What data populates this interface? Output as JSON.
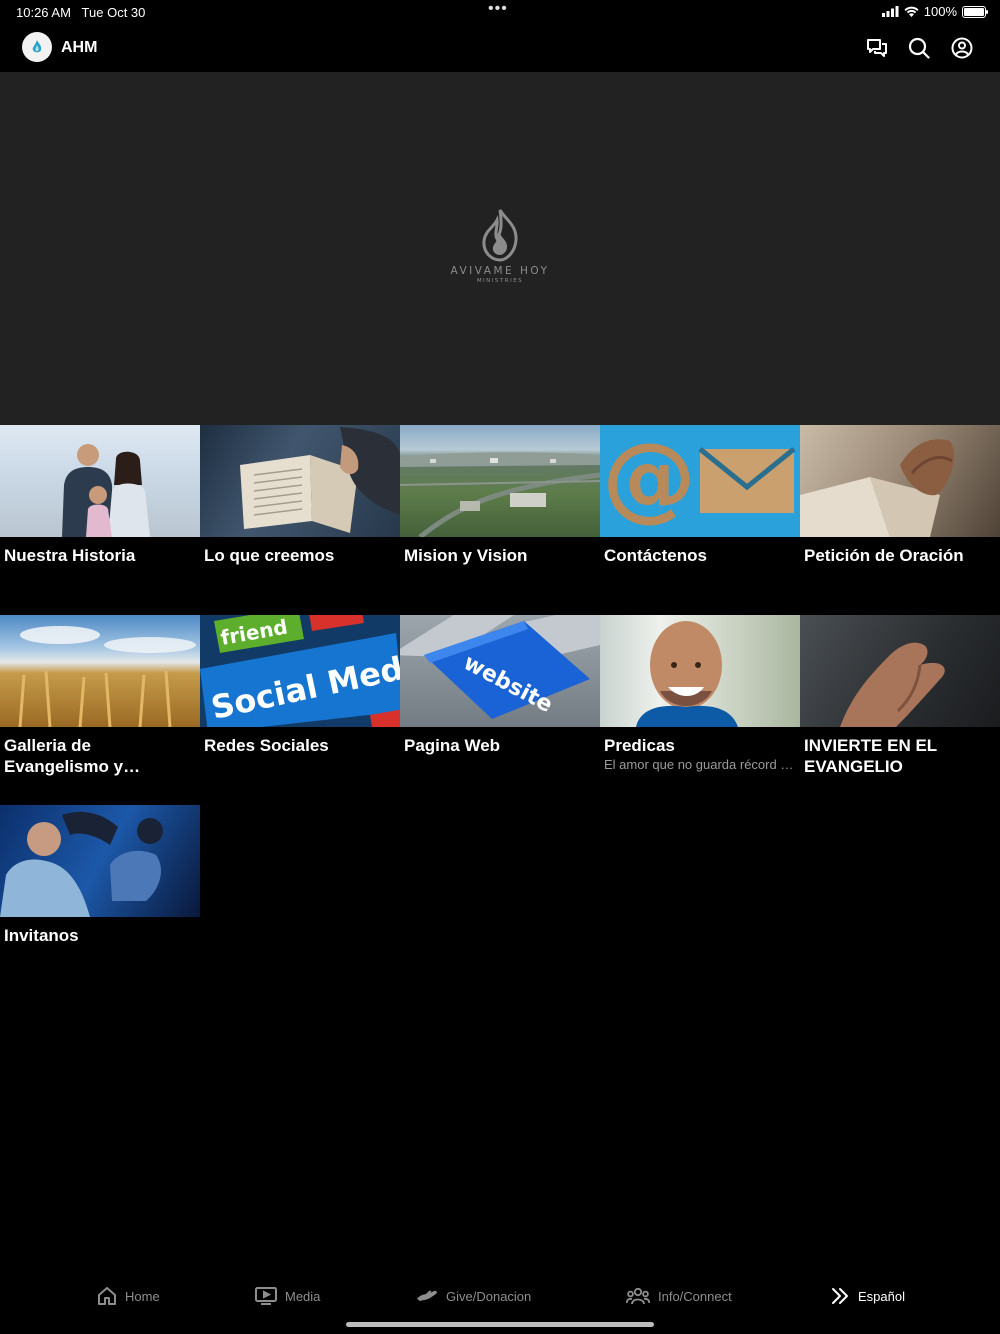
{
  "status_bar": {
    "time": "10:26 AM",
    "date": "Tue Oct 30",
    "battery_percent": "100%",
    "battery_level": 1.0,
    "icons": [
      "cellular-signal-icon",
      "wifi-icon",
      "battery-icon"
    ]
  },
  "header": {
    "title": "AHM",
    "icons": [
      "chat-icon",
      "search-icon",
      "profile-icon"
    ]
  },
  "hero": {
    "logo_text": "AVIVAME HOY",
    "logo_subtext": "MINISTRIES"
  },
  "tiles": [
    {
      "title": "Nuestra Historia",
      "subtitle": ""
    },
    {
      "title": "Lo que creemos",
      "subtitle": ""
    },
    {
      "title": "Mision y Vision",
      "subtitle": ""
    },
    {
      "title": "Contáctenos",
      "subtitle": ""
    },
    {
      "title": "Petición de Oración",
      "subtitle": ""
    },
    {
      "title": "Galleria de Evangelismo y Conferencias",
      "subtitle": ""
    },
    {
      "title": "Redes Sociales",
      "subtitle": "",
      "image_text_1": "friend",
      "image_text_2": "Social Media"
    },
    {
      "title": "Pagina Web",
      "subtitle": "",
      "image_text": "website"
    },
    {
      "title": "Predicas",
      "subtitle": "El amor que no guarda récord de ofensas"
    },
    {
      "title": "INVIERTE EN EL EVANGELIO",
      "subtitle": ""
    },
    {
      "title": "Invitanos",
      "subtitle": ""
    }
  ],
  "tabbar": {
    "tabs": [
      {
        "label": "Home",
        "icon": "home-icon"
      },
      {
        "label": "Media",
        "icon": "tv-play-icon"
      },
      {
        "label": "Give/Donacion",
        "icon": "hand-give-icon"
      },
      {
        "label": "Info/Connect",
        "icon": "people-icon"
      },
      {
        "label": "Español",
        "icon": "double-chevron-icon"
      }
    ],
    "active_tab": "Español"
  },
  "colors": {
    "background": "#000000",
    "hero_background": "#222222",
    "inactive_tab": "#8e8e8e",
    "subtitle": "#9a9a9a"
  }
}
